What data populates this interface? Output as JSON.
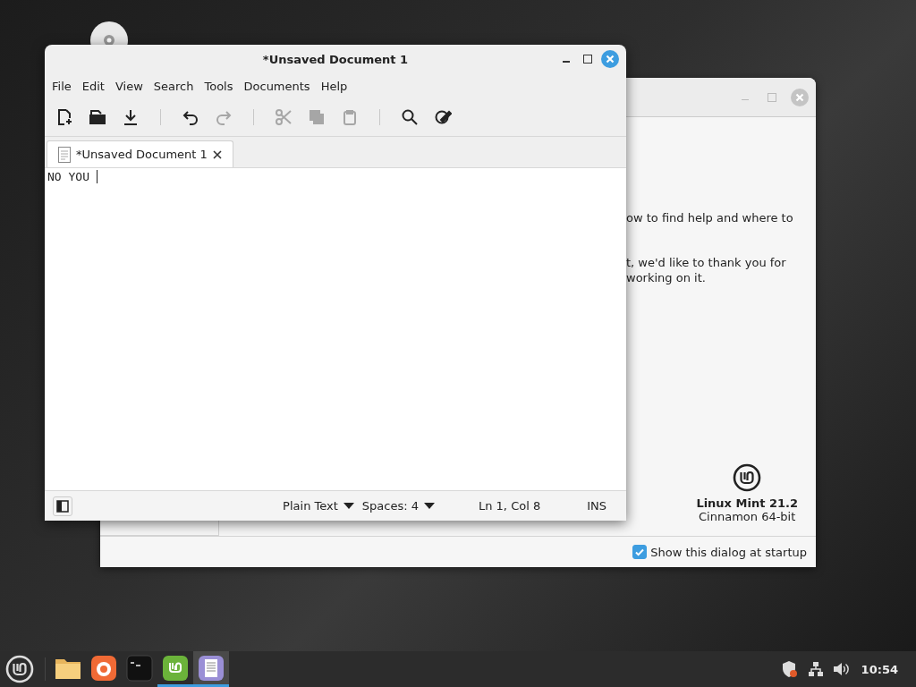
{
  "welcome_window": {
    "text_lines": [
      "ow to find help and where to",
      "t, we'd like to thank you for",
      "working on it."
    ],
    "product_name": "Linux Mint 21.2",
    "edition": "Cinnamon 64-bit",
    "startup_option": {
      "label": "Show this dialog at startup",
      "checked": true
    }
  },
  "editor_window": {
    "title": "*Unsaved Document 1",
    "menu": [
      "File",
      "Edit",
      "View",
      "Search",
      "Tools",
      "Documents",
      "Help"
    ],
    "toolbar": [
      {
        "kind": "new",
        "disabled": false
      },
      {
        "kind": "open",
        "disabled": false
      },
      {
        "kind": "save",
        "disabled": false
      },
      {
        "kind": "sep"
      },
      {
        "kind": "undo",
        "disabled": false
      },
      {
        "kind": "redo",
        "disabled": true
      },
      {
        "kind": "sep"
      },
      {
        "kind": "cut",
        "disabled": true
      },
      {
        "kind": "copy",
        "disabled": true
      },
      {
        "kind": "paste",
        "disabled": true
      },
      {
        "kind": "sep"
      },
      {
        "kind": "find",
        "disabled": false
      },
      {
        "kind": "replace",
        "disabled": false
      }
    ],
    "tabs": [
      {
        "label": "*Unsaved Document 1",
        "selected": true
      }
    ],
    "text": "NO YOU ",
    "status_bar": {
      "language": "Plain Text",
      "indent": "Spaces: 4",
      "position": "Ln 1, Col 8",
      "mode": "INS"
    }
  },
  "taskbar": {
    "apps": [
      {
        "kind": "files",
        "running": false,
        "selected": false
      },
      {
        "kind": "browser",
        "running": false,
        "selected": false
      },
      {
        "kind": "terminal",
        "running": false,
        "selected": false
      },
      {
        "kind": "mint",
        "running": true,
        "selected": false
      },
      {
        "kind": "editor",
        "running": true,
        "selected": true
      }
    ],
    "clock": "10:54"
  }
}
